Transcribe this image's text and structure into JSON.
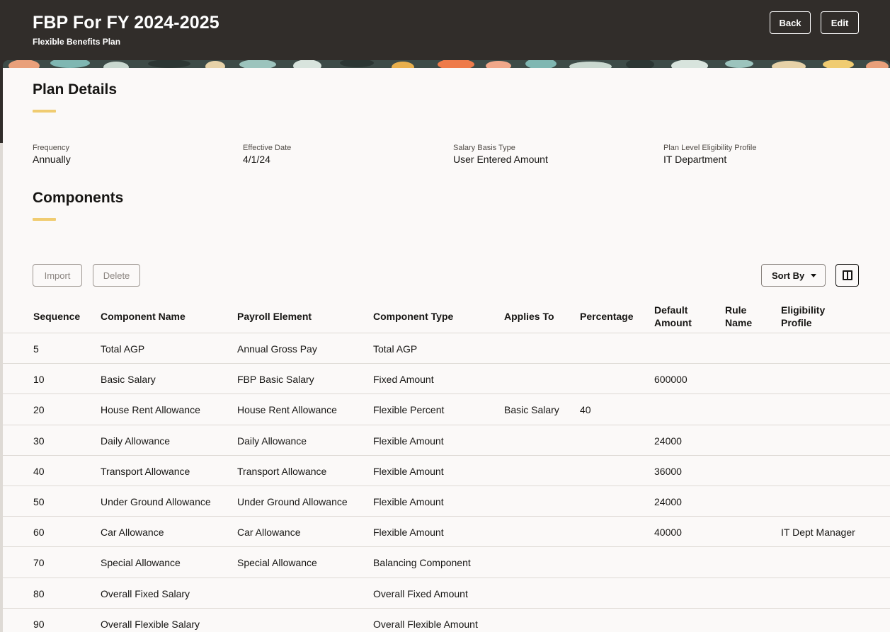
{
  "header": {
    "title": "FBP For FY 2024-2025",
    "subtitle": "Flexible Benefits Plan",
    "back_label": "Back",
    "edit_label": "Edit"
  },
  "plan_details": {
    "title": "Plan Details",
    "fields": [
      {
        "label": "Frequency",
        "value": "Annually"
      },
      {
        "label": "Effective Date",
        "value": "4/1/24"
      },
      {
        "label": "Salary Basis Type",
        "value": "User Entered Amount"
      },
      {
        "label": "Plan Level Eligibility Profile",
        "value": "IT Department"
      }
    ]
  },
  "components": {
    "title": "Components",
    "import_label": "Import",
    "delete_label": "Delete",
    "sort_label": "Sort By",
    "columns": [
      {
        "key": "seq",
        "label": "Sequence"
      },
      {
        "key": "name",
        "label": "Component Name"
      },
      {
        "key": "pay",
        "label": "Payroll Element"
      },
      {
        "key": "type",
        "label": "Component Type"
      },
      {
        "key": "app",
        "label": "Applies To"
      },
      {
        "key": "pct",
        "label": "Percentage"
      },
      {
        "key": "def",
        "label": "Default Amount"
      },
      {
        "key": "rule",
        "label": "Rule Name"
      },
      {
        "key": "elig",
        "label": "Eligibility Profile"
      }
    ],
    "rows": [
      {
        "seq": "5",
        "name": "Total AGP",
        "pay": "Annual Gross Pay",
        "type": "Total AGP",
        "app": "",
        "pct": "",
        "def": "",
        "rule": "",
        "elig": ""
      },
      {
        "seq": "10",
        "name": "Basic Salary",
        "pay": "FBP Basic Salary",
        "type": "Fixed Amount",
        "app": "",
        "pct": "",
        "def": "600000",
        "rule": "",
        "elig": ""
      },
      {
        "seq": "20",
        "name": "House Rent Allowance",
        "pay": "House Rent Allowance",
        "type": "Flexible Percent",
        "app": "Basic Salary",
        "pct": "40",
        "def": "",
        "rule": "",
        "elig": ""
      },
      {
        "seq": "30",
        "name": "Daily Allowance",
        "pay": "Daily Allowance",
        "type": "Flexible Amount",
        "app": "",
        "pct": "",
        "def": "24000",
        "rule": "",
        "elig": ""
      },
      {
        "seq": "40",
        "name": "Transport Allowance",
        "pay": "Transport Allowance",
        "type": "Flexible Amount",
        "app": "",
        "pct": "",
        "def": "36000",
        "rule": "",
        "elig": ""
      },
      {
        "seq": "50",
        "name": "Under Ground Allowance",
        "pay": "Under Ground Allowance",
        "type": "Flexible Amount",
        "app": "",
        "pct": "",
        "def": "24000",
        "rule": "",
        "elig": ""
      },
      {
        "seq": "60",
        "name": "Car Allowance",
        "pay": "Car Allowance",
        "type": "Flexible Amount",
        "app": "",
        "pct": "",
        "def": "40000",
        "rule": "",
        "elig": "IT Dept Manager"
      },
      {
        "seq": "70",
        "name": "Special Allowance",
        "pay": "Special Allowance",
        "type": "Balancing Component",
        "app": "",
        "pct": "",
        "def": "",
        "rule": "",
        "elig": ""
      },
      {
        "seq": "80",
        "name": "Overall Fixed Salary",
        "pay": "",
        "type": "Overall Fixed Amount",
        "app": "",
        "pct": "",
        "def": "",
        "rule": "",
        "elig": ""
      },
      {
        "seq": "90",
        "name": "Overall Flexible Salary",
        "pay": "",
        "type": "Overall Flexible Amount",
        "app": "",
        "pct": "",
        "def": "",
        "rule": "",
        "elig": ""
      }
    ]
  }
}
